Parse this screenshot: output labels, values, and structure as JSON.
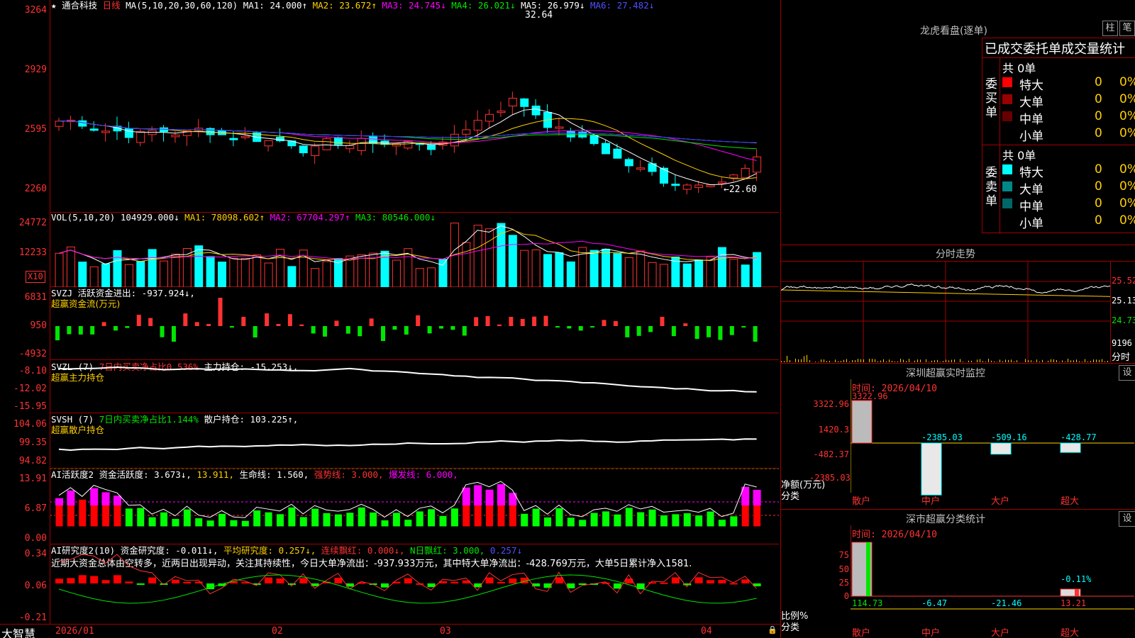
{
  "main": {
    "star": "★",
    "stock": "通合科技",
    "period": "日线",
    "ma_params": "MA(5,10,20,30,60,120)",
    "ma1": "MA1: 24.000↑",
    "ma2": "MA2: 23.672↑",
    "ma3": "MA3: 24.745↓",
    "ma4": "MA4: 26.021↓",
    "ma5": "MA5: 26.979↓",
    "ma6": "MA6: 27.482↓",
    "high_label": "32.64",
    "low_label": "←22.60",
    "y_ticks": [
      "3264",
      "2929",
      "2595",
      "2260"
    ]
  },
  "vol": {
    "params": "VOL(5,10,20)",
    "value": "104929.000↓",
    "ma1": "MA1: 78098.602↑",
    "ma2": "MA2: 67704.297↑",
    "ma3": "MA3: 80546.000↓",
    "y_ticks": [
      "24772",
      "12233"
    ],
    "unit": "X10"
  },
  "svzj": {
    "name": "SVZJ",
    "label": "活跃资金进出: -937.924↓,",
    "sub": "超赢资金流(万元)",
    "y_ticks": [
      "6831",
      "950",
      "-4932"
    ]
  },
  "svzl": {
    "name": "SVZL (7)",
    "pct": "7日内买卖净占比0.536%",
    "label": "主力持仓: -15.253↓,",
    "sub": "超赢主力持仓",
    "y_ticks": [
      "-8.10",
      "-12.02",
      "-15.95"
    ]
  },
  "svsh": {
    "name": "SVSH (7)",
    "pct": "7日内买卖净占比1.144%",
    "label": "散户持仓: 103.225↑,",
    "sub": "超赢散户持仓",
    "y_ticks": [
      "104.06",
      "99.35",
      "94.82"
    ]
  },
  "ai1": {
    "name": "AI活跃度2",
    "act": "资金活跃度: 3.673↓,",
    "v2": "13.911,",
    "life": "生命线: 1.560,",
    "strong": "强势线: 3.000,",
    "burst": "爆发线: 6.000,",
    "y_ticks": [
      "13.91",
      "6.87",
      "0.00"
    ]
  },
  "ai2": {
    "name": "AI研究度2(10)",
    "research": "资金研究度: -0.011↓,",
    "avg": "平均研究度: 0.257↓,",
    "cont": "连续飘红: 0.000↓,",
    "nday": "N日飘红: 3.000,",
    "last": "0.257↓",
    "note": "近期大资金总体由空转多，近两日出现异动，关注其持续性，今日大单净流出：-937.933万元，其中特大单净流出：-428.769万元，大单5日累计净入1581.",
    "y_ticks": [
      "0.34",
      "0.06",
      "-0.21"
    ]
  },
  "xaxis": {
    "brand": "大智慧",
    "labels": [
      "2026/01",
      "02",
      "03",
      "04"
    ]
  },
  "right": {
    "title": "龙虎看盘(逐单)",
    "btn_col": "柱",
    "btn_bi": "笔",
    "stat_title": "已成交委托单成交量统计",
    "buy_side": "委买单",
    "sell_side": "委卖单",
    "buy_total": "共 0单",
    "sell_total": "共 0单",
    "rows": [
      "特大",
      "大单",
      "中单",
      "小单"
    ],
    "zero": "0",
    "pct": "0%",
    "buy_colors": [
      "#ff0000",
      "#990000",
      "#660000",
      "#000000"
    ],
    "sell_colors": [
      "#00ffff",
      "#008888",
      "#006666",
      "#000000"
    ],
    "intraday_title": "分时走势",
    "intraday_y": [
      "25.52",
      "25.13",
      "24.73"
    ],
    "intraday_vol": "9196",
    "intraday_unit": "分时",
    "sz_title": "深圳超赢实时监控",
    "sz_btn": "设",
    "sz_time": "时间: 2026/04/10",
    "sz_y": [
      "3322.96",
      "1420.3",
      "-482.37",
      "-2385.03"
    ],
    "sz_unit1": "净额(万元)",
    "sz_unit2": "分类",
    "sz_cats": [
      "散户",
      "中户",
      "大户",
      "超大"
    ],
    "sz_vals": [
      "3322.96",
      "-2385.03",
      "-509.16",
      "-428.77"
    ],
    "cls_title": "深市超赢分类统计",
    "cls_btn": "设",
    "cls_time": "时间: 2026/04/10",
    "cls_y": [
      "75",
      "50",
      "25",
      "0"
    ],
    "cls_unit1": "比例%",
    "cls_unit2": "分类",
    "cls_cats": [
      "散户",
      "中户",
      "大户",
      "超大"
    ],
    "cls_vals": [
      "114.73",
      "-6.47",
      "-21.46",
      "13.21"
    ],
    "cls_top": "-0.11%"
  },
  "colors": {
    "up": "#ff3232",
    "down": "#00ffff",
    "frame": "#a00000",
    "buy_net": "#00e600"
  }
}
